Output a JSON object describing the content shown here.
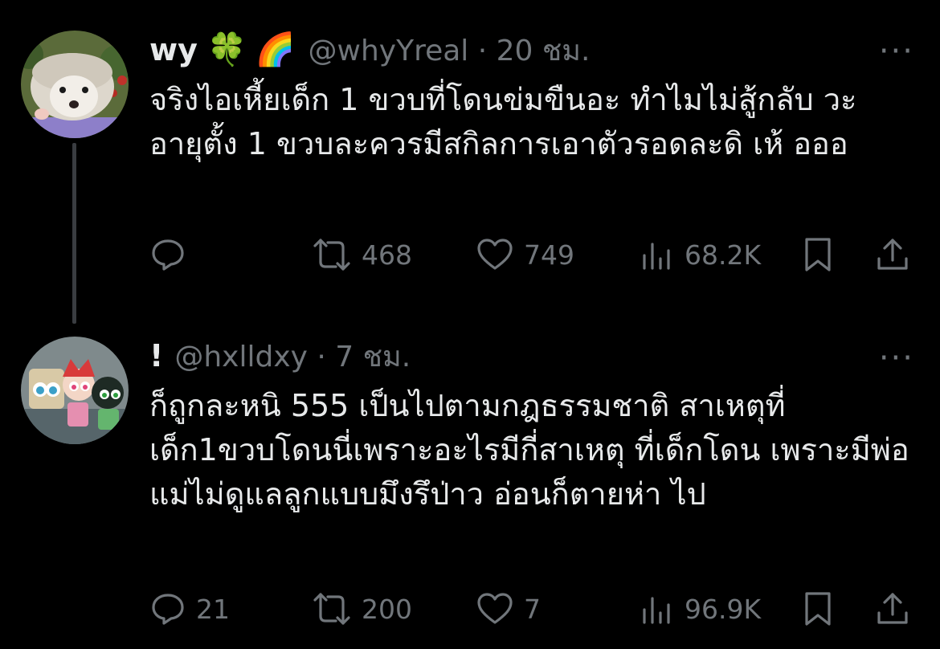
{
  "tweets": [
    {
      "name": "wy",
      "emojis": [
        "🍀",
        "🌈"
      ],
      "handle_time": "@whyYreal · 20 ชม.",
      "more": "···",
      "text": "จริงไอเหี้ยเด็ก 1 ขวบที่โดนข่มขืนอะ ทำไมไม่สู้กลับ วะ อายุตั้ง 1 ขวบละควรมีสกิลการเอาตัวรอดละดิ เห้ อออ",
      "replies": "",
      "reposts": "468",
      "likes": "749",
      "views": "68.2K"
    },
    {
      "name": "!",
      "emojis": [],
      "handle_time": "@hxlldxy · 7 ชม.",
      "more": "···",
      "text": "ก็ถูกละหนิ 555 เป็นไปตามกฎธรรมชาติ สาเหตุที่ เด็ก1ขวบโดนนี่เพราะอะไรมีกี่สาเหตุ ที่เด็กโดน เพราะมีพ่อแม่ไม่ดูแลลูกแบบมึงรึป่าว อ่อนก็ตายห่า ไป",
      "replies": "21",
      "reposts": "200",
      "likes": "7",
      "views": "96.9K"
    }
  ],
  "icons": [
    "reply-icon",
    "repost-icon",
    "like-icon",
    "views-icon",
    "bookmark-icon",
    "share-icon"
  ],
  "colors": {
    "background": "#000000",
    "text": "#e7e9ea",
    "muted": "#71767b",
    "thread_line": "#3a3d41"
  }
}
